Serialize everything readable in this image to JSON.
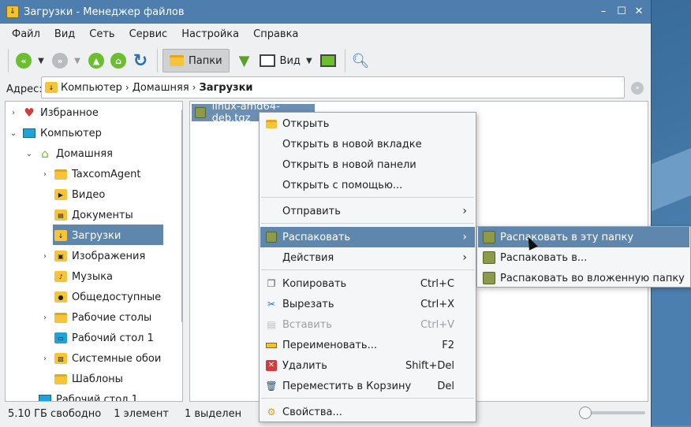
{
  "window": {
    "title": "Загрузки - Менеджер файлов",
    "controls": [
      "minimize-icon",
      "maximize-icon",
      "close-icon"
    ]
  },
  "menubar": [
    "Файл",
    "Вид",
    "Сеть",
    "Сервис",
    "Настройка",
    "Справка"
  ],
  "toolbar": {
    "folders_label": "Папки",
    "view_label": "Вид"
  },
  "address": {
    "label": "Адрес:",
    "crumbs": [
      "Компьютер",
      "Домашняя",
      "Загрузки"
    ]
  },
  "tree": [
    {
      "label": "Избранное",
      "icon": "favorites-icon"
    },
    {
      "label": "Компьютер",
      "icon": "computer-icon"
    },
    {
      "label": "Домашняя",
      "icon": "home-icon"
    },
    {
      "label": "TaxcomAgent",
      "icon": "folder-icon"
    },
    {
      "label": "Видео",
      "icon": "video-folder-icon"
    },
    {
      "label": "Документы",
      "icon": "documents-folder-icon"
    },
    {
      "label": "Загрузки",
      "icon": "downloads-folder-icon"
    },
    {
      "label": "Изображения",
      "icon": "images-folder-icon"
    },
    {
      "label": "Музыка",
      "icon": "music-folder-icon"
    },
    {
      "label": "Общедоступные",
      "icon": "public-folder-icon"
    },
    {
      "label": "Рабочие столы",
      "icon": "folder-icon"
    },
    {
      "label": "Рабочий стол 1",
      "icon": "desktop-folder-icon"
    },
    {
      "label": "Системные обои",
      "icon": "wallpaper-folder-icon"
    },
    {
      "label": "Шаблоны",
      "icon": "templates-folder-icon"
    },
    {
      "label": "Рабочий стол 1",
      "icon": "desktop-folder-icon"
    }
  ],
  "files": [
    {
      "name": "linux-amd64-deb.tgz",
      "icon": "archive-icon"
    }
  ],
  "context_menu": {
    "open": "Открыть",
    "open_tab": "Открыть в новой вкладке",
    "open_panel": "Открыть в новой панели",
    "open_with": "Открыть с помощью...",
    "send": "Отправить",
    "extract": "Распаковать",
    "actions": "Действия",
    "copy": "Копировать",
    "copy_sc": "Ctrl+C",
    "cut": "Вырезать",
    "cut_sc": "Ctrl+X",
    "paste": "Вставить",
    "paste_sc": "Ctrl+V",
    "rename": "Переименовать...",
    "rename_sc": "F2",
    "delete": "Удалить",
    "delete_sc": "Shift+Del",
    "trash": "Переместить в Корзину",
    "trash_sc": "Del",
    "properties": "Свойства..."
  },
  "submenu": {
    "extract_here": "Распаковать в эту папку",
    "extract_to": "Распаковать в...",
    "extract_sub": "Распаковать во вложенную папку"
  },
  "status": {
    "free": "5.10 ГБ свободно",
    "count": "1 элемент",
    "selected": "1 выделен"
  },
  "colors": {
    "titlebar": "#4d7eae",
    "selection": "#5f87ad",
    "folder": "#f5c43a"
  }
}
